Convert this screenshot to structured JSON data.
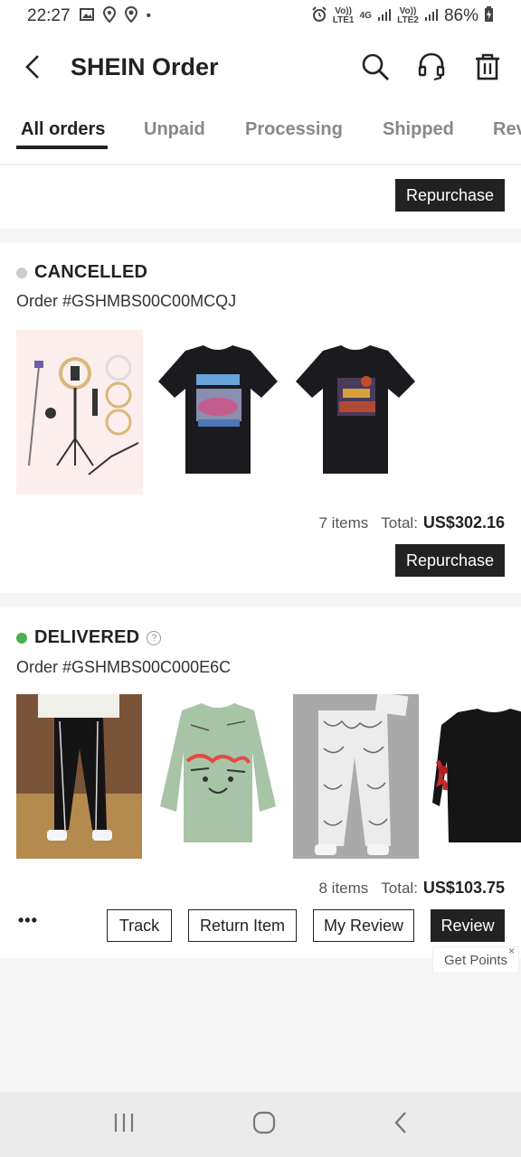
{
  "status_bar": {
    "time": "22:27",
    "carrier1": "Vo)) LTE1",
    "carrier2": "Vo)) LTE2",
    "network": "4G",
    "battery": "86%"
  },
  "header": {
    "title": "SHEIN Order"
  },
  "tabs": [
    "All orders",
    "Unpaid",
    "Processing",
    "Shipped",
    "Rev"
  ],
  "top_card": {
    "button": "Repurchase"
  },
  "order_cancelled": {
    "status": "CANCELLED",
    "status_color": "#cccccc",
    "order_number": "Order #GSHMBS00C00MCQJ",
    "items_count": "7 items",
    "total_label": "Total:",
    "total_amount": "US$302.16",
    "button": "Repurchase"
  },
  "order_delivered": {
    "status": "DELIVERED",
    "status_color": "#4caf50",
    "order_number": "Order #GSHMBS00C000E6C",
    "items_count": "8 items",
    "total_label": "Total:",
    "total_amount": "US$103.75",
    "more": "•••",
    "buttons": {
      "track": "Track",
      "return_item": "Return Item",
      "my_review": "My Review",
      "review": "Review"
    },
    "tooltip": "Get Points"
  }
}
